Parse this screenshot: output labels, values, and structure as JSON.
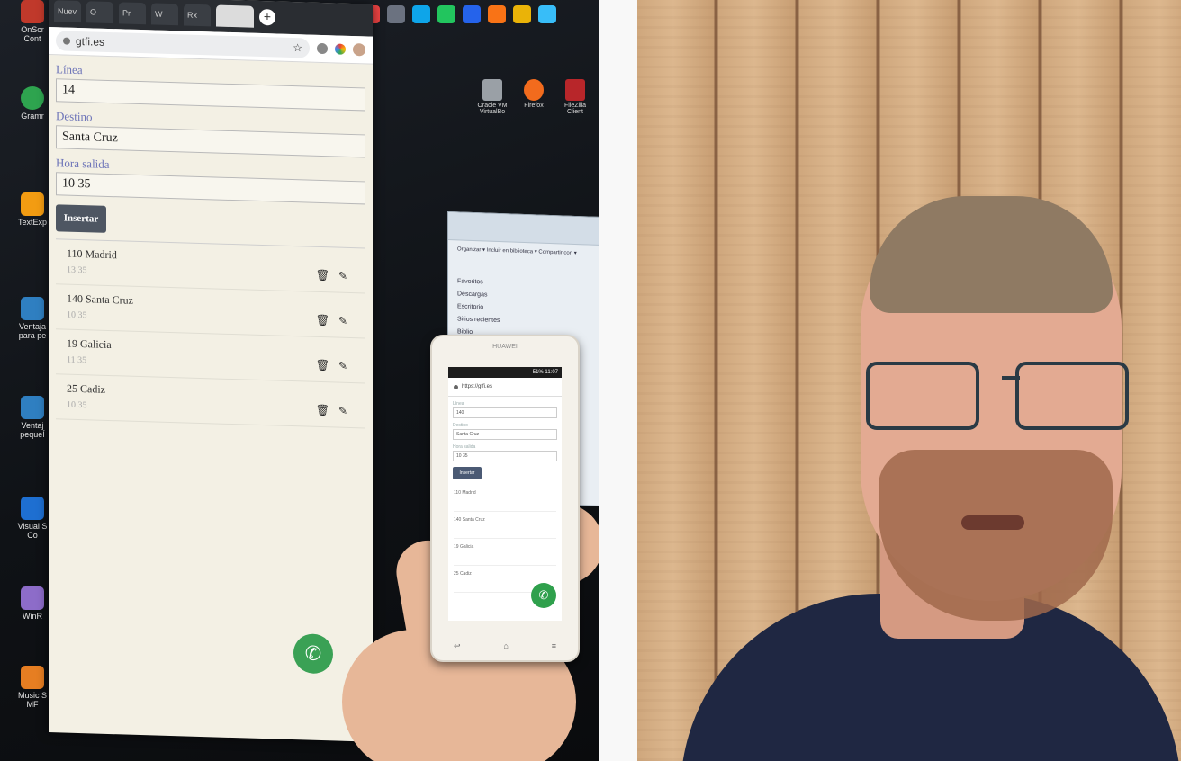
{
  "browser": {
    "url": "gtfi.es",
    "new_tab_symbol": "+",
    "tabs": [
      "Nuev",
      "O",
      "Pr",
      "W",
      "Rx"
    ]
  },
  "form": {
    "linea_label": "Línea",
    "linea_value": "14",
    "destino_label": "Destino",
    "destino_value": "Santa Cruz",
    "hora_label": "Hora salida",
    "hora_value": "10 35",
    "insert_label": "Insertar"
  },
  "list": [
    {
      "title": "110 Madrid",
      "time": "13 35"
    },
    {
      "title": "140 Santa Cruz",
      "time": "10 35"
    },
    {
      "title": "19 Galicia",
      "time": "11 35"
    },
    {
      "title": "25 Cadiz",
      "time": "10 35"
    }
  ],
  "icons": {
    "delete": "🗑",
    "edit": "✎",
    "whatsapp": "✆",
    "colors": {
      "whatsapp": "#3aa155",
      "button": "#4e5662",
      "label": "#6d74b8"
    }
  },
  "desktop_icons": [
    {
      "label": "OnScr\nCont",
      "color": "#c0392b"
    },
    {
      "label": "Gramr",
      "color": "#2ea44f"
    },
    {
      "label": "TextExp",
      "color": "#f39c12"
    },
    {
      "label": "Ventaja\npara pe",
      "color": "#2f7fc1"
    },
    {
      "label": "Ventaj\npequeÍ",
      "color": "#2f7fc1"
    },
    {
      "label": "Visual S\nCo",
      "color": "#1e6fd1"
    },
    {
      "label": "WinR",
      "color": "#8d6cc9"
    },
    {
      "label": "Music S\nMF",
      "color": "#e67e22"
    }
  ],
  "desktop_right": [
    {
      "label": "Oracle VM\nVirtualBo",
      "color": "#9aa0a6"
    },
    {
      "label": "Firefox",
      "color": "#f26b1d"
    },
    {
      "label": "FileZilla Client",
      "color": "#b8262a"
    }
  ],
  "explorer": {
    "items": [
      "Favoritos",
      "Descargas",
      "Escritorio",
      "Sitios recientes",
      "Biblio"
    ],
    "toolbar": "Organizar ▾   Incluir en biblioteca ▾   Compartir con ▾"
  },
  "phone": {
    "brand": "HUAWEI",
    "status": "51% 11:07",
    "url": "https://gtfi.es",
    "fields": [
      "Línea",
      "140",
      "Destino",
      "Santa Cruz",
      "Hora salida",
      "10 35"
    ],
    "button": "Insertar",
    "rows": [
      "110 Madrid",
      "140 Santa Cruz",
      "19 Galicia",
      "25 Cadiz"
    ]
  }
}
